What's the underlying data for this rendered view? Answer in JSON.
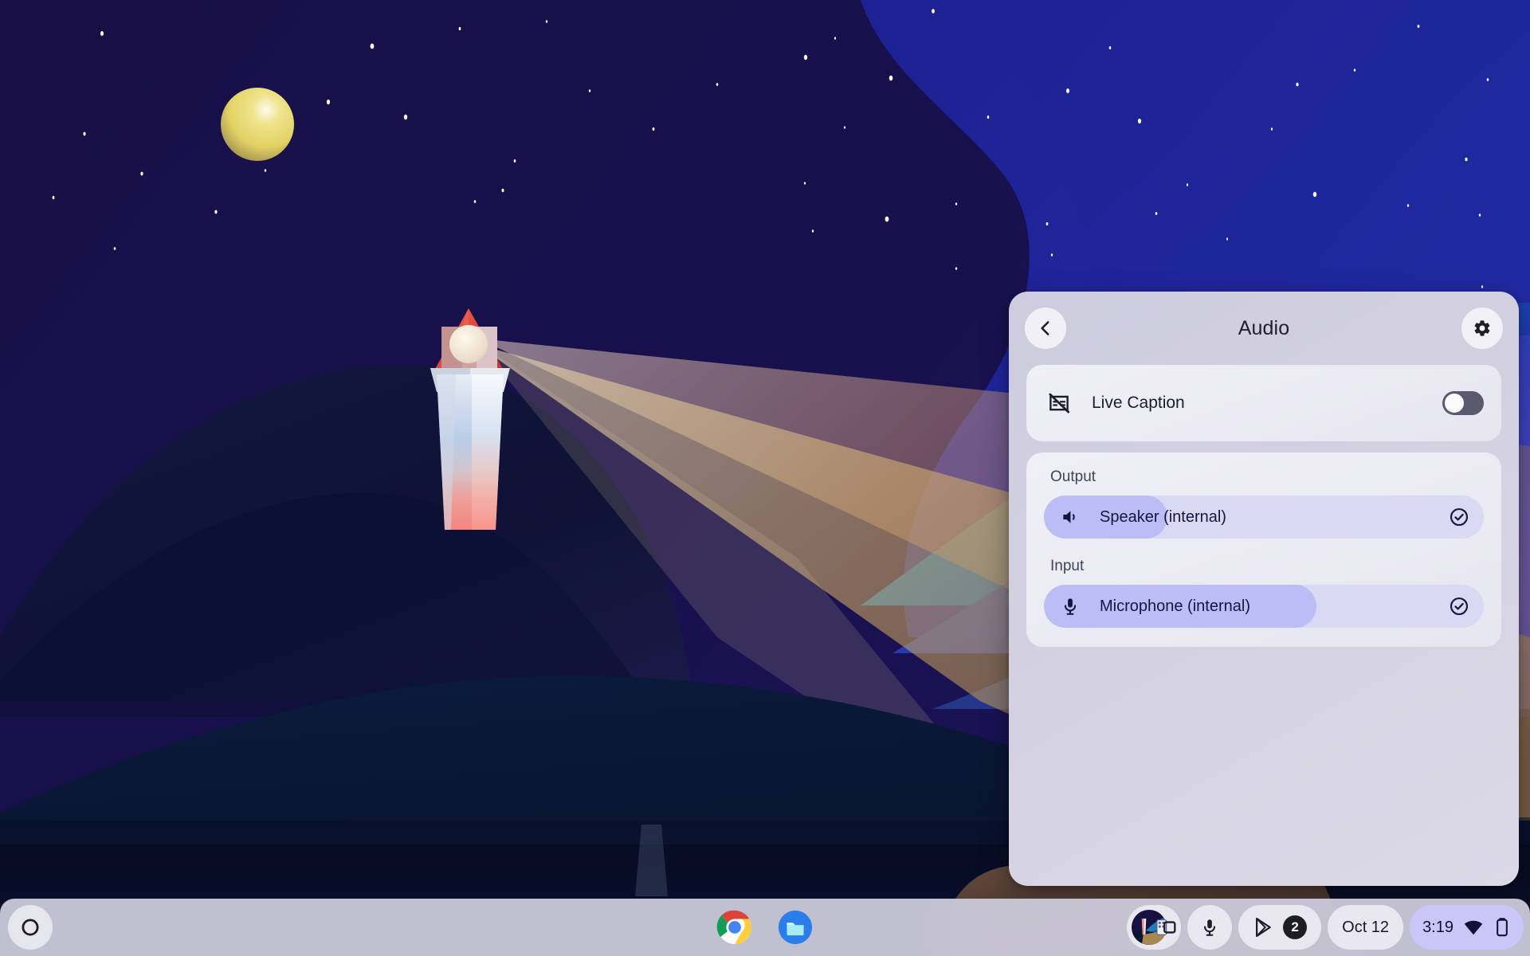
{
  "wallpaper": {
    "name": "lighthouse-night-wallpaper",
    "colors": {
      "sky_dark": "#140f44",
      "sky_blue": "#1b2494",
      "ridge_teal": "#0f9fb8",
      "ridge_blue": "#2540c4",
      "ridge_indigo": "#3b3fb2",
      "hill_dark": "#10123a",
      "ground": "#0a1430",
      "water": "#070b22",
      "rock_brown": "#5a4338",
      "beam_gold": "#c9a463",
      "beam_rose": "#c08a78",
      "moon_yellow": "#e8d86a",
      "roof_red": "#e0453a"
    }
  },
  "panel": {
    "title": "Audio",
    "back_button_label": "Back",
    "settings_button_label": "Settings",
    "live_caption": {
      "label": "Live Caption",
      "icon": "live-caption-off-icon",
      "toggle_state": "off"
    },
    "output": {
      "group_label": "Output",
      "devices": [
        {
          "name": "Speaker (internal)",
          "icon": "speaker-icon",
          "selected": true,
          "volume_percent": 28
        }
      ]
    },
    "input": {
      "group_label": "Input",
      "devices": [
        {
          "name": "Microphone (internal)",
          "icon": "microphone-icon",
          "selected": true,
          "gain_percent": 62
        }
      ]
    },
    "colors": {
      "accent_fill": "#bcbcf7",
      "track": "#d9d9f4",
      "text": "#161641"
    }
  },
  "shelf": {
    "launcher_label": "Launcher",
    "apps": [
      {
        "name": "Google Chrome",
        "icon": "chrome-icon"
      },
      {
        "name": "Files",
        "icon": "files-icon"
      }
    ],
    "status": {
      "desk_button_label": "Desks",
      "desk_icon": "screen-cast-icon",
      "microphone_icon": "microphone-icon",
      "play_store_icon": "play-store-icon",
      "play_store_badge": "2",
      "date": "Oct 12",
      "time": "3:19",
      "wifi_icon": "wifi-icon",
      "battery_icon": "battery-icon",
      "tray_color": "#c8c7f8"
    }
  }
}
